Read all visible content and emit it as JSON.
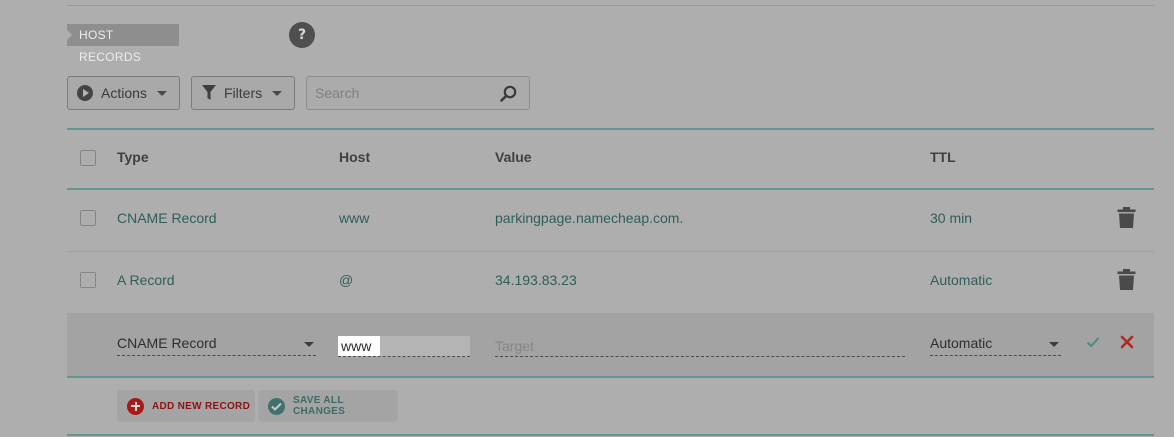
{
  "section": {
    "title": "HOST RECORDS",
    "help": "?"
  },
  "toolbar": {
    "actions_label": "Actions",
    "filters_label": "Filters",
    "search_placeholder": "Search"
  },
  "table": {
    "headers": {
      "type": "Type",
      "host": "Host",
      "value": "Value",
      "ttl": "TTL"
    },
    "rows": [
      {
        "type": "CNAME Record",
        "host": "www",
        "value": "parkingpage.namecheap.com.",
        "ttl": "30 min"
      },
      {
        "type": "A Record",
        "host": "@",
        "value": "34.193.83.23",
        "ttl": "Automatic"
      }
    ],
    "edit_row": {
      "type": "CNAME Record",
      "host": "www",
      "value_placeholder": "Target",
      "ttl": "Automatic"
    }
  },
  "footer": {
    "add_label": "ADD NEW RECORD",
    "save_label": "SAVE ALL CHANGES"
  },
  "colors": {
    "teal": "#2f5e5a",
    "accent_line": "#5f9690",
    "danger": "#a61a1a"
  }
}
